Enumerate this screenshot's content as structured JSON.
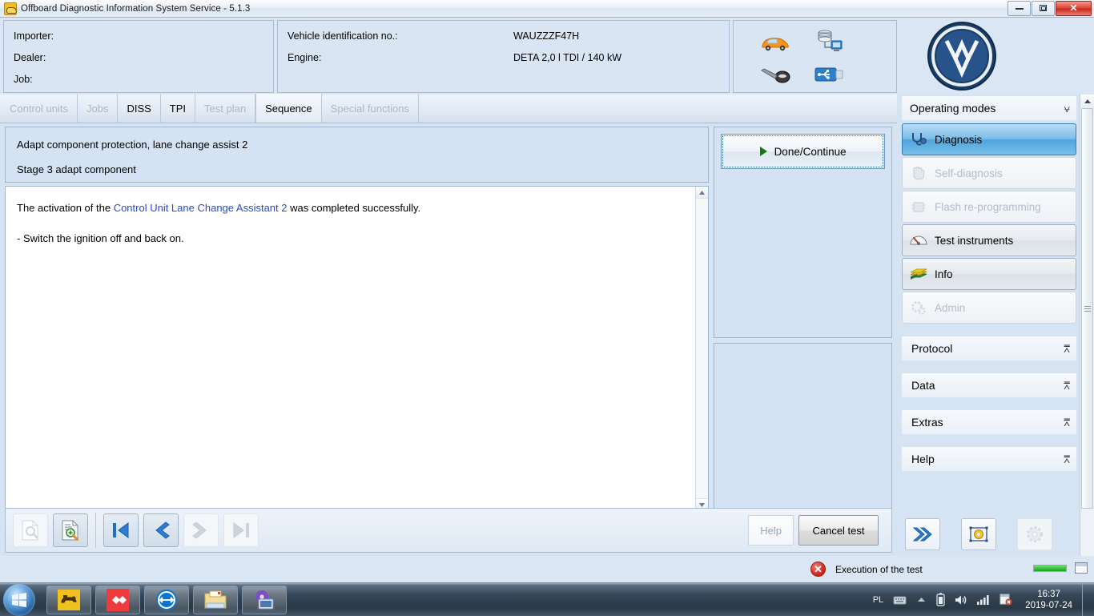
{
  "window": {
    "title": "Offboard Diagnostic Information System Service - 5.1.3",
    "app_icon": "car-engine-icon",
    "minimize_label": "–",
    "restore_label": "❐",
    "close_label": "✕"
  },
  "header": {
    "left_fields": [
      {
        "label": "Importer:",
        "value": ""
      },
      {
        "label": "Dealer:",
        "value": ""
      },
      {
        "label": "Job:",
        "value": ""
      }
    ],
    "vehicle_fields": [
      {
        "label": "Vehicle identification no.:",
        "value": "WAUZZZF47H"
      },
      {
        "label": "Engine:",
        "value": "DETA 2,0 l TDI / 140 kW"
      }
    ],
    "icons": [
      "car-icon",
      "server-network-icon",
      "key-icon",
      "usb-icon",
      "info-icon"
    ],
    "brand_logo": "vw-logo"
  },
  "tabs": [
    {
      "label": "Control units",
      "state": "disabled"
    },
    {
      "label": "Jobs",
      "state": "disabled"
    },
    {
      "label": "DISS",
      "state": "enabled"
    },
    {
      "label": "TPI",
      "state": "enabled"
    },
    {
      "label": "Test plan",
      "state": "disabled"
    },
    {
      "label": "Sequence",
      "state": "active"
    },
    {
      "label": "Special functions",
      "state": "disabled"
    }
  ],
  "task": {
    "title": "Adapt component protection, lane change assist 2",
    "stage": "Stage 3 adapt component"
  },
  "document": {
    "paragraph_1_pre": "The activation of the ",
    "paragraph_1_link": "Control Unit Lane Change Assistant 2",
    "paragraph_1_post": " was completed successfully.",
    "paragraph_2": "- Switch the ignition off and back on."
  },
  "actions": {
    "done_continue": "Done/Continue",
    "done_icon": "play-triangle-icon"
  },
  "toolbar": {
    "buttons": [
      {
        "name": "document-preview-button",
        "icon": "document-search-icon",
        "state": "disabled"
      },
      {
        "name": "document-zoom-button",
        "icon": "document-zoom-icon",
        "state": "enabled"
      },
      {
        "name": "first-page-button",
        "icon": "first-page-icon",
        "state": "enabled"
      },
      {
        "name": "previous-page-button",
        "icon": "previous-page-icon",
        "state": "enabled"
      },
      {
        "name": "next-page-button",
        "icon": "next-page-icon",
        "state": "disabled"
      },
      {
        "name": "last-page-button",
        "icon": "last-page-icon",
        "state": "disabled"
      }
    ],
    "help_label": "Help",
    "help_state": "disabled",
    "cancel_label": "Cancel test",
    "cancel_state": "enabled"
  },
  "sidebar": {
    "operating_modes_title": "Operating modes",
    "collapse_icon": "chevron-up-icon",
    "modes": [
      {
        "label": "Diagnosis",
        "icon": "stethoscope-icon",
        "state": "active"
      },
      {
        "label": "Self-diagnosis",
        "icon": "hand-icon",
        "state": "disabled"
      },
      {
        "label": "Flash re-programming",
        "icon": "flash-chip-icon",
        "state": "disabled"
      },
      {
        "label": "Test instruments",
        "icon": "gauge-icon",
        "state": "enabled"
      },
      {
        "label": "Info",
        "icon": "books-icon",
        "state": "enabled"
      },
      {
        "label": "Admin",
        "icon": "gears-icon",
        "state": "disabled"
      }
    ],
    "sections": [
      {
        "label": "Protocol",
        "icon": "chevron-down-icon"
      },
      {
        "label": "Data",
        "icon": "chevron-down-icon"
      },
      {
        "label": "Extras",
        "icon": "chevron-down-icon"
      },
      {
        "label": "Help",
        "icon": "chevron-down-icon"
      }
    ],
    "bottom_buttons": [
      {
        "name": "fast-forward-button",
        "icon": "double-chevron-right-icon",
        "state": "enabled"
      },
      {
        "name": "focus-target-button",
        "icon": "target-frame-icon",
        "state": "enabled"
      },
      {
        "name": "settings-button",
        "icon": "gear-icon",
        "state": "disabled"
      }
    ]
  },
  "statusbar": {
    "icon": "error-icon",
    "message": "Execution of the test",
    "progress_percent": 100
  },
  "taskbar": {
    "start_icon": "windows-start-orb",
    "items": [
      {
        "name": "odis-taskbar-item",
        "icon": "engine-icon"
      },
      {
        "name": "red-app-taskbar-item",
        "icon": "red-diamond-icon"
      },
      {
        "name": "teamviewer-taskbar-item",
        "icon": "teamviewer-icon"
      },
      {
        "name": "explorer-taskbar-item",
        "icon": "folder-icon"
      },
      {
        "name": "media-app-taskbar-item",
        "icon": "purple-disc-icon"
      }
    ],
    "tray": {
      "language": "PL",
      "icons": [
        "keyboard-icon",
        "eject-icon",
        "battery-icon",
        "volume-icon",
        "network-signal-icon",
        "action-center-icon"
      ],
      "time": "16:37",
      "date": "2019-07-24"
    }
  },
  "colors": {
    "accent_blue": "#4ea5de",
    "panel_blue": "#d4e2f4",
    "link_blue": "#2b49c4",
    "error_red": "#cc2018",
    "progress_green": "#17a317"
  }
}
